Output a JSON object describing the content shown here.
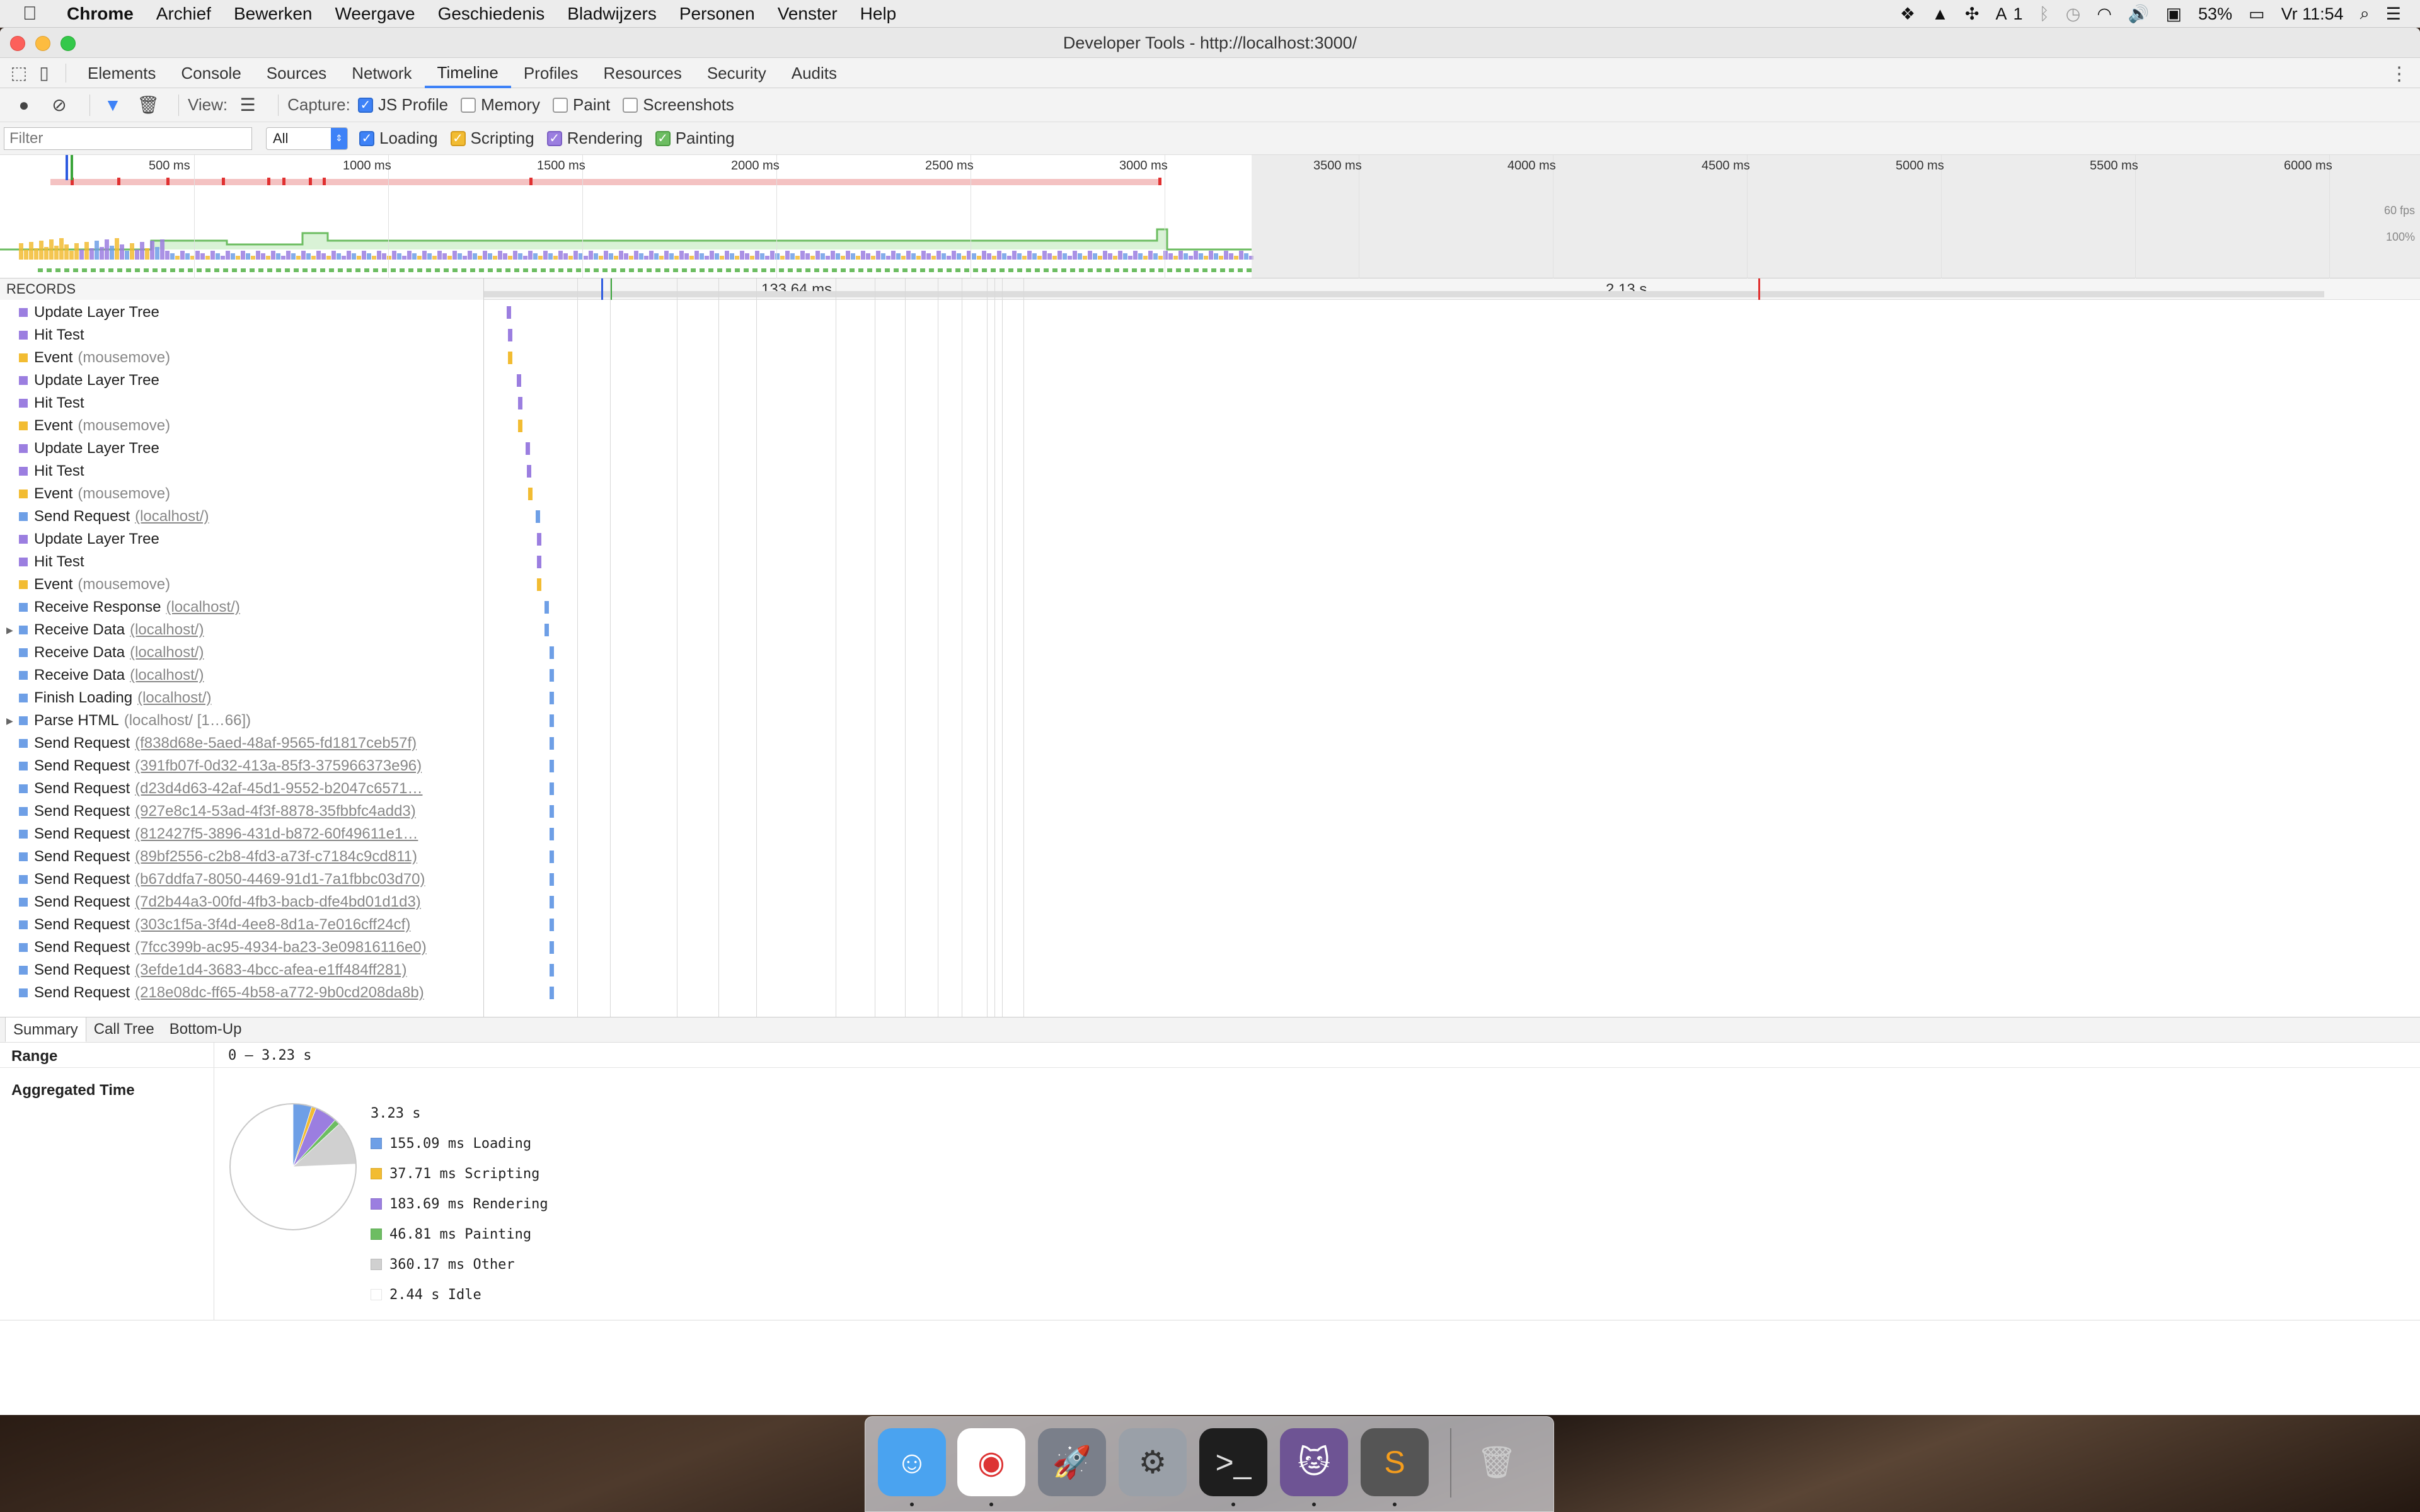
{
  "menubar": {
    "app": "Chrome",
    "items": [
      "Archief",
      "Bewerken",
      "Weergave",
      "Geschiedenis",
      "Bladwijzers",
      "Personen",
      "Venster",
      "Help"
    ],
    "status": {
      "battery": "53%",
      "time": "Vr 11:54",
      "adobe_count": "1"
    }
  },
  "window": {
    "title": "Developer Tools - http://localhost:3000/"
  },
  "devtools": {
    "tabs": [
      "Elements",
      "Console",
      "Sources",
      "Network",
      "Timeline",
      "Profiles",
      "Resources",
      "Security",
      "Audits"
    ],
    "active_tab": "Timeline"
  },
  "toolbar": {
    "view_label": "View:",
    "capture_label": "Capture:",
    "capture": [
      {
        "label": "JS Profile",
        "checked": true
      },
      {
        "label": "Memory",
        "checked": false
      },
      {
        "label": "Paint",
        "checked": false
      },
      {
        "label": "Screenshots",
        "checked": false
      }
    ],
    "filter_placeholder": "Filter",
    "filter_select": "All",
    "categories": [
      {
        "label": "Loading",
        "color": "#3e82f7"
      },
      {
        "label": "Scripting",
        "color": "#f2bc32"
      },
      {
        "label": "Rendering",
        "color": "#9b7ee0"
      },
      {
        "label": "Painting",
        "color": "#6dbd62"
      }
    ]
  },
  "overview": {
    "ticks": [
      "500 ms",
      "1000 ms",
      "1500 ms",
      "2000 ms",
      "2500 ms",
      "3000 ms",
      "3500 ms",
      "4000 ms",
      "4500 ms",
      "5000 ms",
      "5500 ms",
      "6000 ms"
    ],
    "fps_label": "60 fps",
    "cpu_label": "100%"
  },
  "records": {
    "header": "RECORDS",
    "flame_labels": [
      "133.64 ms",
      "2.13 s"
    ],
    "items": [
      {
        "name": "Update Layer Tree",
        "detail": "",
        "cat": "rendering"
      },
      {
        "name": "Hit Test",
        "detail": "",
        "cat": "rendering"
      },
      {
        "name": "Event",
        "detail": "(mousemove)",
        "cat": "scripting"
      },
      {
        "name": "Update Layer Tree",
        "detail": "",
        "cat": "rendering"
      },
      {
        "name": "Hit Test",
        "detail": "",
        "cat": "rendering"
      },
      {
        "name": "Event",
        "detail": "(mousemove)",
        "cat": "scripting"
      },
      {
        "name": "Update Layer Tree",
        "detail": "",
        "cat": "rendering"
      },
      {
        "name": "Hit Test",
        "detail": "",
        "cat": "rendering"
      },
      {
        "name": "Event",
        "detail": "(mousemove)",
        "cat": "scripting"
      },
      {
        "name": "Send Request",
        "detail": "(localhost/)",
        "cat": "loading",
        "link": true
      },
      {
        "name": "Update Layer Tree",
        "detail": "",
        "cat": "rendering"
      },
      {
        "name": "Hit Test",
        "detail": "",
        "cat": "rendering"
      },
      {
        "name": "Event",
        "detail": "(mousemove)",
        "cat": "scripting"
      },
      {
        "name": "Receive Response",
        "detail": "(localhost/)",
        "cat": "loading",
        "link": true
      },
      {
        "name": "Receive Data",
        "detail": "(localhost/)",
        "cat": "loading",
        "link": true,
        "expandable": true
      },
      {
        "name": "Receive Data",
        "detail": "(localhost/)",
        "cat": "loading",
        "link": true
      },
      {
        "name": "Receive Data",
        "detail": "(localhost/)",
        "cat": "loading",
        "link": true
      },
      {
        "name": "Finish Loading",
        "detail": "(localhost/)",
        "cat": "loading",
        "link": true
      },
      {
        "name": "Parse HTML",
        "detail": "(localhost/ [1…66])",
        "cat": "loading",
        "expandable": true
      },
      {
        "name": "Send Request",
        "detail": "(f838d68e-5aed-48af-9565-fd1817ceb57f)",
        "cat": "loading",
        "link": true
      },
      {
        "name": "Send Request",
        "detail": "(391fb07f-0d32-413a-85f3-375966373e96)",
        "cat": "loading",
        "link": true
      },
      {
        "name": "Send Request",
        "detail": "(d23d4d63-42af-45d1-9552-b2047c6571…",
        "cat": "loading",
        "link": true
      },
      {
        "name": "Send Request",
        "detail": "(927e8c14-53ad-4f3f-8878-35fbbfc4add3)",
        "cat": "loading",
        "link": true
      },
      {
        "name": "Send Request",
        "detail": "(812427f5-3896-431d-b872-60f49611e1…",
        "cat": "loading",
        "link": true
      },
      {
        "name": "Send Request",
        "detail": "(89bf2556-c2b8-4fd3-a73f-c7184c9cd811)",
        "cat": "loading",
        "link": true
      },
      {
        "name": "Send Request",
        "detail": "(b67ddfa7-8050-4469-91d1-7a1fbbc03d70)",
        "cat": "loading",
        "link": true
      },
      {
        "name": "Send Request",
        "detail": "(7d2b44a3-00fd-4fb3-bacb-dfe4bd01d1d3)",
        "cat": "loading",
        "link": true
      },
      {
        "name": "Send Request",
        "detail": "(303c1f5a-3f4d-4ee8-8d1a-7e016cff24cf)",
        "cat": "loading",
        "link": true
      },
      {
        "name": "Send Request",
        "detail": "(7fcc399b-ac95-4934-ba23-3e09816116e0)",
        "cat": "loading",
        "link": true
      },
      {
        "name": "Send Request",
        "detail": "(3efde1d4-3683-4bcc-afea-e1ff484ff281)",
        "cat": "loading",
        "link": true
      },
      {
        "name": "Send Request",
        "detail": "(218e08dc-ff65-4b58-a772-9b0cd208da8b)",
        "cat": "loading",
        "link": true
      }
    ]
  },
  "colors": {
    "loading": "#6e9fe6",
    "scripting": "#f2bc32",
    "rendering": "#9b7ee0",
    "painting": "#6dbd62",
    "other": "#d0d0d0",
    "idle": "#ffffff"
  },
  "summary": {
    "tabs": [
      "Summary",
      "Call Tree",
      "Bottom-Up"
    ],
    "range_label": "Range",
    "range_value": "0 – 3.23 s",
    "aggregated_label": "Aggregated Time",
    "total": "3.23 s",
    "legend": [
      {
        "label": "155.09 ms Loading",
        "ms": 155.09,
        "color": "#6e9fe6"
      },
      {
        "label": "37.71 ms Scripting",
        "ms": 37.71,
        "color": "#f2bc32"
      },
      {
        "label": "183.69 ms Rendering",
        "ms": 183.69,
        "color": "#9b7ee0"
      },
      {
        "label": "46.81 ms Painting",
        "ms": 46.81,
        "color": "#6dbd62"
      },
      {
        "label": "360.17 ms Other",
        "ms": 360.17,
        "color": "#d0d0d0"
      },
      {
        "label": "2.44 s Idle",
        "ms": 2440,
        "color": "#ffffff"
      }
    ]
  },
  "dock": {
    "items": [
      {
        "name": "finder-icon",
        "glyph": "☺",
        "running": true
      },
      {
        "name": "chrome-icon",
        "glyph": "◉",
        "running": true
      },
      {
        "name": "launchpad-icon",
        "glyph": "🚀",
        "running": false
      },
      {
        "name": "system-preferences-icon",
        "glyph": "⚙",
        "running": false
      },
      {
        "name": "terminal-icon",
        "glyph": ">_",
        "running": true
      },
      {
        "name": "github-icon",
        "glyph": "🐱",
        "running": true
      },
      {
        "name": "sublime-text-icon",
        "glyph": "S",
        "running": true
      },
      {
        "name": "trash-icon",
        "glyph": "🗑",
        "running": false
      }
    ]
  }
}
